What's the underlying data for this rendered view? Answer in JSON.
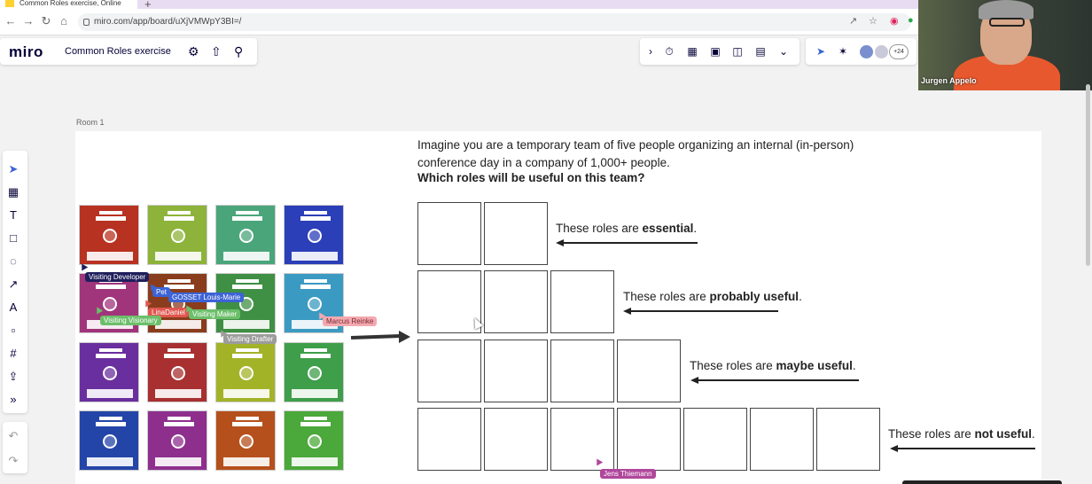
{
  "browser": {
    "tab_title": "Common Roles exercise, Online",
    "new_tab": "+",
    "url": "miro.com/app/board/uXjVMWpY3BI=/"
  },
  "miro": {
    "logo": "miro",
    "board_title": "Common Roles exercise",
    "collaborators_more": "+24"
  },
  "video": {
    "name": "Jurgen Appelo"
  },
  "frame": {
    "room_label": "Room 1",
    "question_line1": "Imagine you are a temporary team of five people organizing an internal (in-person)",
    "question_line2": "conference day in a company of 1,000+ people.",
    "question_bold": "Which roles will be useful on this team?"
  },
  "rows": [
    {
      "prefix": "These roles are ",
      "bold": "essential",
      "suffix": "."
    },
    {
      "prefix": "These roles are ",
      "bold": "probably useful",
      "suffix": "."
    },
    {
      "prefix": "These roles are ",
      "bold": "maybe useful",
      "suffix": "."
    },
    {
      "prefix": "These roles are ",
      "bold": "not useful",
      "suffix": "."
    }
  ],
  "cards": [
    {
      "color": "#b83221"
    },
    {
      "color": "#8db33a"
    },
    {
      "color": "#4aa57a"
    },
    {
      "color": "#2b3fb8"
    },
    {
      "color": "#a1357b"
    },
    {
      "color": "#8a3d1c"
    },
    {
      "color": "#3f8f44"
    },
    {
      "color": "#3b9ac2"
    },
    {
      "color": "#6a2f9e"
    },
    {
      "color": "#a83030"
    },
    {
      "color": "#a3b328"
    },
    {
      "color": "#3e9e4a"
    },
    {
      "color": "#2445a8"
    },
    {
      "color": "#8e2f8e"
    },
    {
      "color": "#b5501c"
    },
    {
      "color": "#4ba83a"
    }
  ],
  "cursors": [
    {
      "label": "Visiting Developer",
      "color": "#1f1f5c"
    },
    {
      "label": "Pet",
      "color": "#3d63d6"
    },
    {
      "label": "GOSSET Louis-Marie",
      "color": "#3d63d6"
    },
    {
      "label": "LinaDaniel",
      "color": "#e0564f"
    },
    {
      "label": "Visiting Maker",
      "color": "#6cbf6a"
    },
    {
      "label": "Visiting Visionary",
      "color": "#6cbf6a"
    },
    {
      "label": "Marcus Reinke",
      "color": "#f4a9b0"
    },
    {
      "label": "Visiting Drafter",
      "color": "#9c9c9c"
    },
    {
      "label": "Jens Thiemann",
      "color": "#b0479b"
    }
  ],
  "colors": {
    "accent": "#050038",
    "tabbar": "#e8dcf3"
  }
}
